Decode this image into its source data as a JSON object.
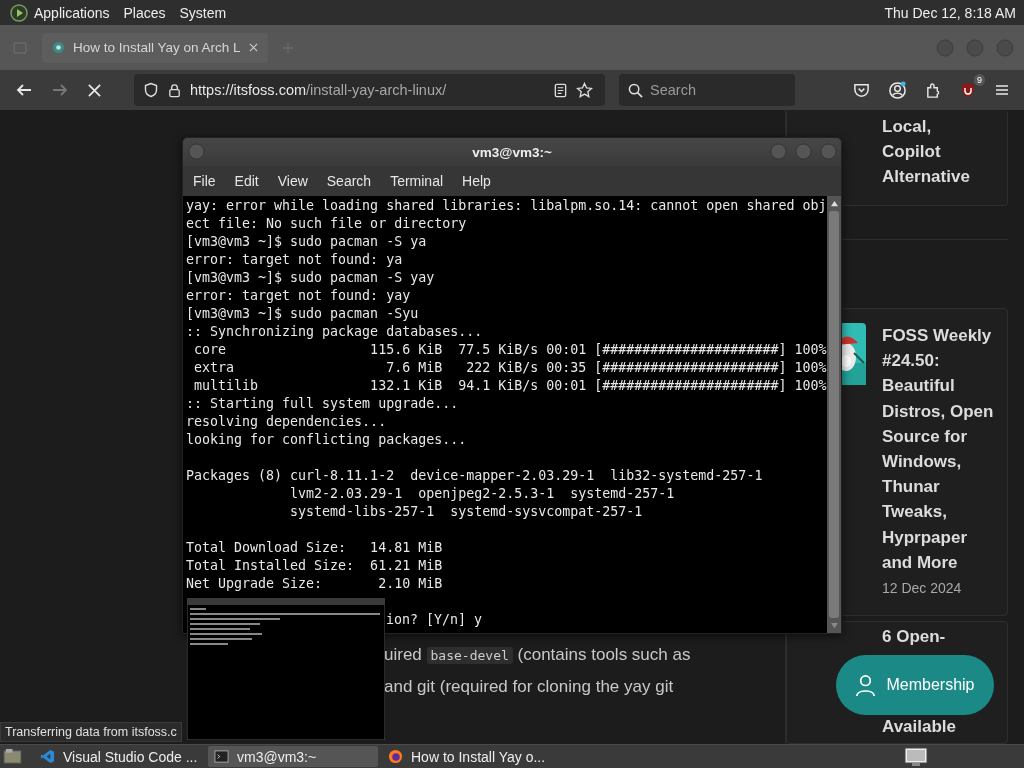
{
  "top_panel": {
    "menus": [
      "Applications",
      "Places",
      "System"
    ],
    "clock": "Thu Dec 12, 8:18 AM"
  },
  "browser": {
    "tabs": [
      {
        "title": "How to Install Yay on Arch L",
        "selected": true
      }
    ],
    "forward_disabled": true,
    "url": {
      "domain": "https://itsfoss.com",
      "path": "/install-yay-arch-linux/"
    },
    "search": {
      "placeholder": "Search"
    },
    "extension_badge": "9",
    "status": "Transferring data from itsfoss.c"
  },
  "article": {
    "lines": [
      [
        {
          "text": "uired "
        },
        {
          "text": "base-devel",
          "kind": "code"
        },
        {
          "text": " (contains tools such as"
        }
      ],
      [
        {
          "text": "and git (required for cloning the yay git"
        }
      ]
    ]
  },
  "sidebar": {
    "cards": [
      {
        "title": "Local, Copilot Alternative"
      },
      {
        "title": "FOSS Weekly #24.50: Beautiful Distros, Open Source for Windows, Thunar Tweaks, Hyprpaper and More",
        "date": "12 Dec 2024"
      },
      {
        "title": "6 Open-",
        "tail": "Available"
      }
    ]
  },
  "membership_button": "Membership",
  "terminal": {
    "title": "vm3@vm3:~",
    "menu": [
      "File",
      "Edit",
      "View",
      "Search",
      "Terminal",
      "Help"
    ],
    "blocks": [
      [
        "yay: error while loading shared libraries: libalpm.so.14: cannot open shared obj",
        "ect file: No such file or directory",
        "[vm3@vm3 ~]$ sudo pacman -S ya",
        "error: target not found: ya",
        "[vm3@vm3 ~]$ sudo pacman -S yay",
        "error: target not found: yay",
        "[vm3@vm3 ~]$ sudo pacman -Syu",
        ":: Synchronizing package databases...",
        " core                  115.6 KiB  77.5 KiB/s 00:01 [######################] 100%",
        " extra                   7.6 MiB   222 KiB/s 00:35 [######################] 100%",
        " multilib              132.1 KiB  94.1 KiB/s 00:01 [######################] 100%",
        ":: Starting full system upgrade...",
        "resolving dependencies...",
        "looking for conflicting packages..."
      ],
      [
        "Packages (8) curl-8.11.1-2  device-mapper-2.03.29-1  lib32-systemd-257-1",
        "             lvm2-2.03.29-1  openjpeg2-2.5.3-1  systemd-257-1",
        "             systemd-libs-257-1  systemd-sysvcompat-257-1"
      ],
      [
        "Total Download Size:   14.81 MiB",
        "Total Installed Size:  61.21 MiB",
        "Net Upgrade Size:       2.10 MiB"
      ]
    ],
    "partial_line": "ion? [Y/n] y"
  },
  "taskbar": {
    "items": [
      {
        "label": "Visual Studio Code ...",
        "kind": "vscode",
        "selected": false
      },
      {
        "label": "vm3@vm3:~",
        "kind": "terminal",
        "selected": true
      },
      {
        "label": "How to Install Yay o...",
        "kind": "firefox",
        "selected": false
      }
    ]
  }
}
